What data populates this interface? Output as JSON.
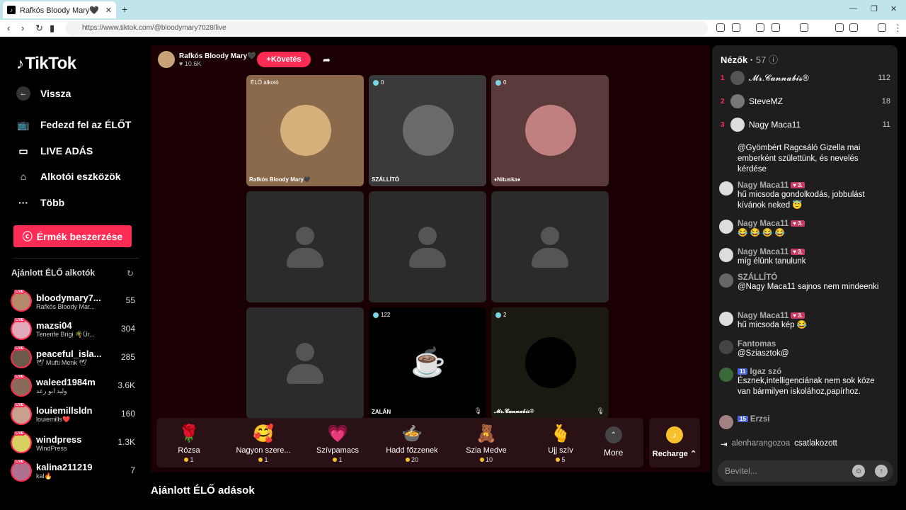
{
  "browser": {
    "tab_title": "Rafkós Bloody Mary🖤 (@blo",
    "url": "https://www.tiktok.com/@bloodymary7028/live"
  },
  "sidebar": {
    "logo": "TikTok",
    "back": "Vissza",
    "items": [
      {
        "label": "Fedezd fel az ÉLŐT",
        "icon": "explore-live-icon"
      },
      {
        "label": "LIVE ADÁS",
        "icon": "video-camera-icon"
      },
      {
        "label": "Alkotói eszközök",
        "icon": "creator-tools-icon"
      },
      {
        "label": "Több",
        "icon": "more-dots-icon"
      }
    ],
    "coin_button": "Érmék beszerzése",
    "recommended_heading": "Ajánlott ÉLŐ alkotók",
    "creators": [
      {
        "name": "bloodymary7...",
        "sub": "Rafkós Bloody Mar...",
        "count": "55",
        "color": "#b58a6a"
      },
      {
        "name": "mazsi04",
        "sub": "Tenerife Brigi 🌴Ür...",
        "count": "304",
        "color": "#e0a8b8"
      },
      {
        "name": "peaceful_isla...",
        "sub": "🕊 Mufti Menk 🕊",
        "count": "285",
        "color": "#6b5a4a"
      },
      {
        "name": "waleed1984m",
        "sub": "وليد ابو رعد",
        "count": "3.6K",
        "color": "#8a6a58"
      },
      {
        "name": "louiemillsldn",
        "sub": "louiemills❤️",
        "count": "160",
        "color": "#c9a090"
      },
      {
        "name": "windpress",
        "sub": "WindPress",
        "count": "1.3K",
        "color": "#d8d060"
      },
      {
        "name": "kalina211219",
        "sub": "kal🔥",
        "count": "7",
        "color": "#b07090"
      }
    ]
  },
  "stage": {
    "host_name": "Rafkós Bloody Mary🖤",
    "host_likes": "10.6K",
    "follow_label": "Követés",
    "cells": [
      {
        "type": "person",
        "badge": "ÉLŐ alkotó",
        "name": "Rafkós Bloody Mary🖤",
        "bg": "#8a6a4a",
        "avatar": "#d6b07a"
      },
      {
        "type": "person",
        "badge": "0",
        "name": "SZÁLLÍTÓ",
        "bg": "#3a3a3a",
        "avatar": "#6a6a6a"
      },
      {
        "type": "person",
        "badge": "0",
        "name": "♦Nituska♦",
        "bg": "#5a3a3a",
        "avatar": "#c08080"
      },
      {
        "type": "empty"
      },
      {
        "type": "empty"
      },
      {
        "type": "empty"
      },
      {
        "type": "empty"
      },
      {
        "type": "dark",
        "badge": "122",
        "name": "ZALÁN",
        "bg": "#000"
      },
      {
        "type": "person",
        "badge": "2",
        "name": "𝓜𝓻.𝓒𝓪𝓷𝓷𝓪𝓫𝓲𝓼®",
        "bg": "#1a1a10",
        "avatar": "#000"
      }
    ],
    "gifts": [
      {
        "name": "Rózsa",
        "price": "1",
        "icon": "🌹"
      },
      {
        "name": "Nagyon szere...",
        "price": "1",
        "icon": "🥰"
      },
      {
        "name": "Szívpamacs",
        "price": "1",
        "icon": "💗"
      },
      {
        "name": "Hadd főzzenek",
        "price": "20",
        "icon": "🍲"
      },
      {
        "name": "Szia Medve",
        "price": "10",
        "icon": "🧸"
      },
      {
        "name": "Ujj szív",
        "price": "5",
        "icon": "🫰"
      }
    ],
    "more_label": "More",
    "recharge_label": "Recharge"
  },
  "footer_heading": "Ajánlott ÉLŐ adások",
  "chat": {
    "viewers_label": "Nézők",
    "viewers_count": "57",
    "top_viewers": [
      {
        "rank": "1",
        "name": "𝓜𝓻.𝓒𝓪𝓷𝓷𝓪𝓫𝓲𝓼®",
        "score": "112",
        "color": "#555"
      },
      {
        "rank": "2",
        "name": "SteveMZ",
        "score": "18",
        "color": "#777"
      },
      {
        "rank": "3",
        "name": "Nagy Maca11",
        "score": "11",
        "color": "#ddd"
      }
    ],
    "messages": [
      {
        "user": "",
        "level": "",
        "text": "@Gyömbért Ragcsáló Gizella mai emberként születtünk, és nevelés kérdése",
        "color": ""
      },
      {
        "user": "Nagy Maca11",
        "level": "3.",
        "text": "hű micsoda gondolkodás, jobbulást kívánok neked 😇",
        "color": "#ddd"
      },
      {
        "user": "Nagy Maca11",
        "level": "3.",
        "text": "😂 😂 😂 😂",
        "color": "#ddd"
      },
      {
        "user": "Nagy Maca11",
        "level": "3.",
        "text": "míg élünk tanulunk",
        "color": "#ddd"
      },
      {
        "user": "SZÁLLÍTÓ",
        "level": "",
        "text": "@Nagy Maca11 sajnos nem mindeenki",
        "color": "#666"
      },
      {
        "user": "Nagy Maca11",
        "level": "3.",
        "text": "hű micsoda kép 😂",
        "color": "#ddd"
      },
      {
        "user": "Fantomas",
        "level": "",
        "text": "@Sziasztok@",
        "color": "#444"
      },
      {
        "user": "Igaz szó",
        "level": "11",
        "text": "Észnek,intelligenciának nem sok köze van bármilyen iskolához,papírhoz.",
        "color": "#3a6a3a"
      },
      {
        "user": "Erzsi",
        "level": "15",
        "text": "",
        "color": "#a08080"
      }
    ],
    "join_user": "alenharangozoa",
    "join_text": "csatlakozott",
    "input_placeholder": "Bevitel..."
  }
}
